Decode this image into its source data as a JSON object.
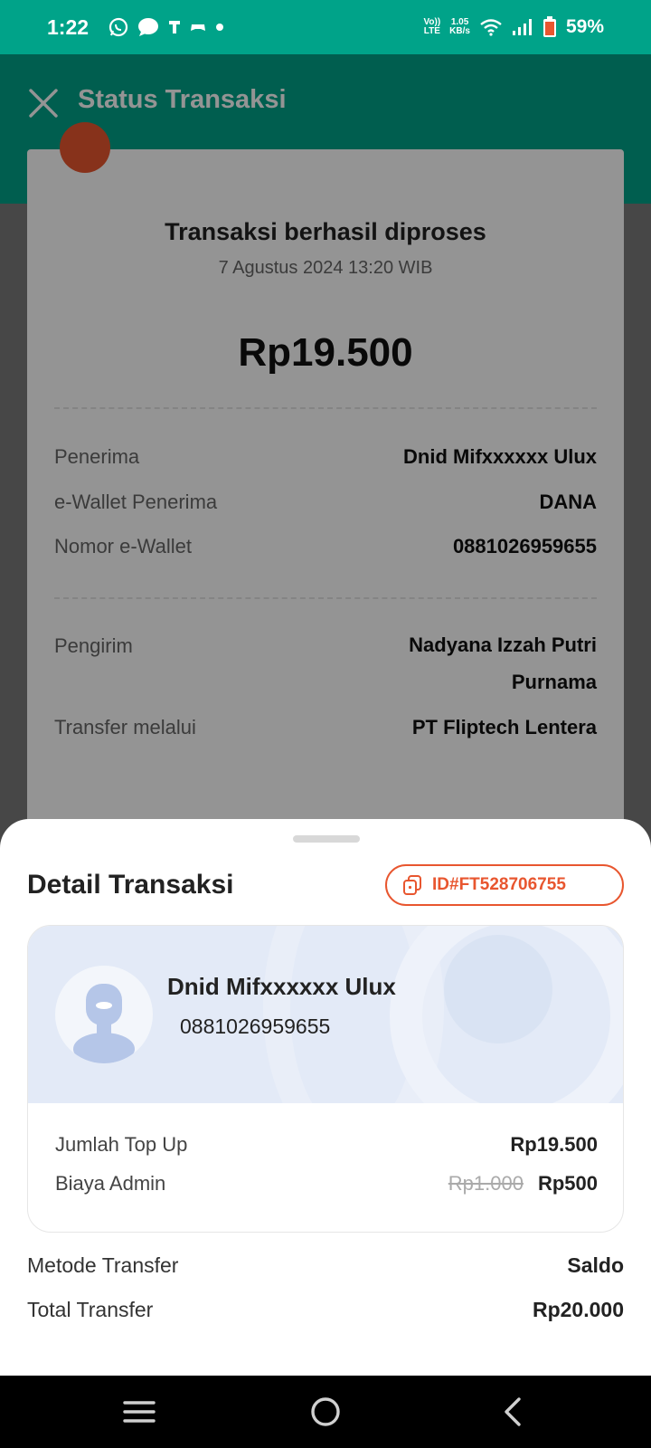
{
  "status_bar": {
    "time": "1:22",
    "network_label_top": "Vo))",
    "network_label_bottom": "LTE",
    "speed_top": "1.05",
    "speed_bottom": "KB/s",
    "battery": "59%"
  },
  "header": {
    "title": "Status Transaksi"
  },
  "background_card": {
    "title": "Transaksi berhasil diproses",
    "date": "7 Agustus 2024 13:20 WIB",
    "amount": "Rp19.500",
    "rows": [
      {
        "label": "Penerima",
        "value": "Dnid Mifxxxxxx Ulux"
      },
      {
        "label": "e-Wallet Penerima",
        "value": "DANA"
      },
      {
        "label": "Nomor e-Wallet",
        "value": "0881026959655"
      },
      {
        "label": "Pengirim",
        "value": "Nadyana Izzah Putri",
        "value2": "Purnama"
      },
      {
        "label": "Transfer melalui",
        "value": "PT Fliptech Lentera"
      }
    ]
  },
  "sheet": {
    "title": "Detail Transaksi",
    "transaction_id": "ID#FT528706755",
    "recipient": {
      "name": "Dnid Mifxxxxxx Ulux",
      "number": "0881026959655"
    },
    "topup_label": "Jumlah Top Up",
    "topup_value": "Rp19.500",
    "admin_label": "Biaya Admin",
    "admin_old": "Rp1.000",
    "admin_value": "Rp500",
    "method_label": "Metode Transfer",
    "method_value": "Saldo",
    "total_label": "Total Transfer",
    "total_value": "Rp20.000"
  },
  "colors": {
    "brand_green": "#00a389",
    "accent_orange": "#e8562f"
  }
}
